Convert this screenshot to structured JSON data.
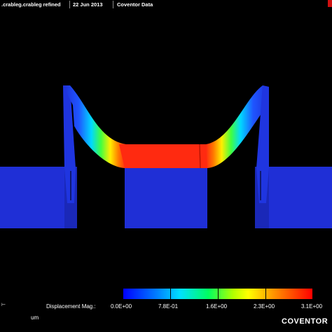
{
  "topbar": {
    "model": ".crableg.crableg refined",
    "date": "22 Jun 2013",
    "source": "Coventor Data"
  },
  "legend": {
    "title": "Displacement Mag.:",
    "ticks": [
      "0.0E+00",
      "7.8E-01",
      "1.6E+00",
      "2.3E+00",
      "3.1E+00"
    ],
    "colors": [
      "#0000ff",
      "#00ffff",
      "#00ff00",
      "#ffff00",
      "#ff0000"
    ]
  },
  "footer": {
    "unit": "um",
    "logo": "COVENTOR"
  },
  "colors": {
    "anchor": "#1f2fd6",
    "background": "#000000"
  }
}
